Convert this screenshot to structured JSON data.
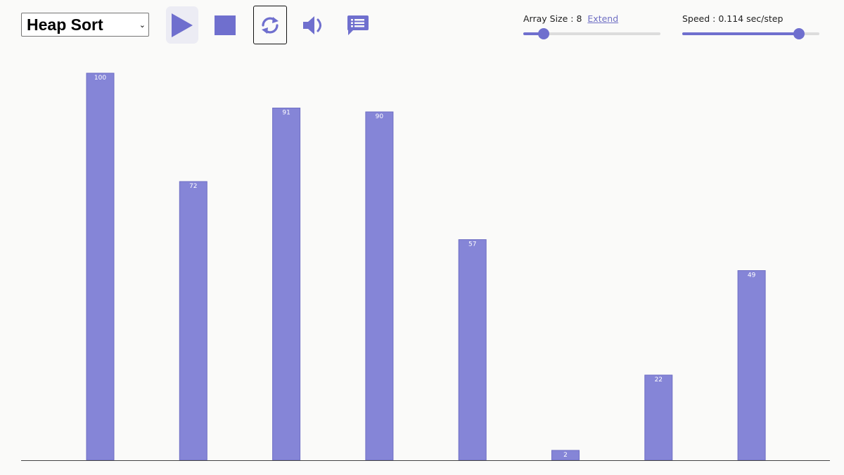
{
  "toolbar": {
    "algorithm": "Heap Sort",
    "icons": [
      "play-icon",
      "stop-icon",
      "refresh-icon",
      "speaker-icon",
      "comment-icon"
    ],
    "accent_color": "#6f6fc4"
  },
  "array_size": {
    "label": "Array Size : 8",
    "extend_link": "Extend",
    "slider_fraction": 0.15
  },
  "speed": {
    "label": "Speed : 0.114 sec/step",
    "slider_fraction": 0.85
  },
  "chart_data": {
    "type": "bar",
    "values": [
      100,
      72,
      91,
      90,
      57,
      2,
      22,
      49
    ],
    "ylim": [
      0,
      100
    ],
    "bar_color": "#8585d7"
  }
}
